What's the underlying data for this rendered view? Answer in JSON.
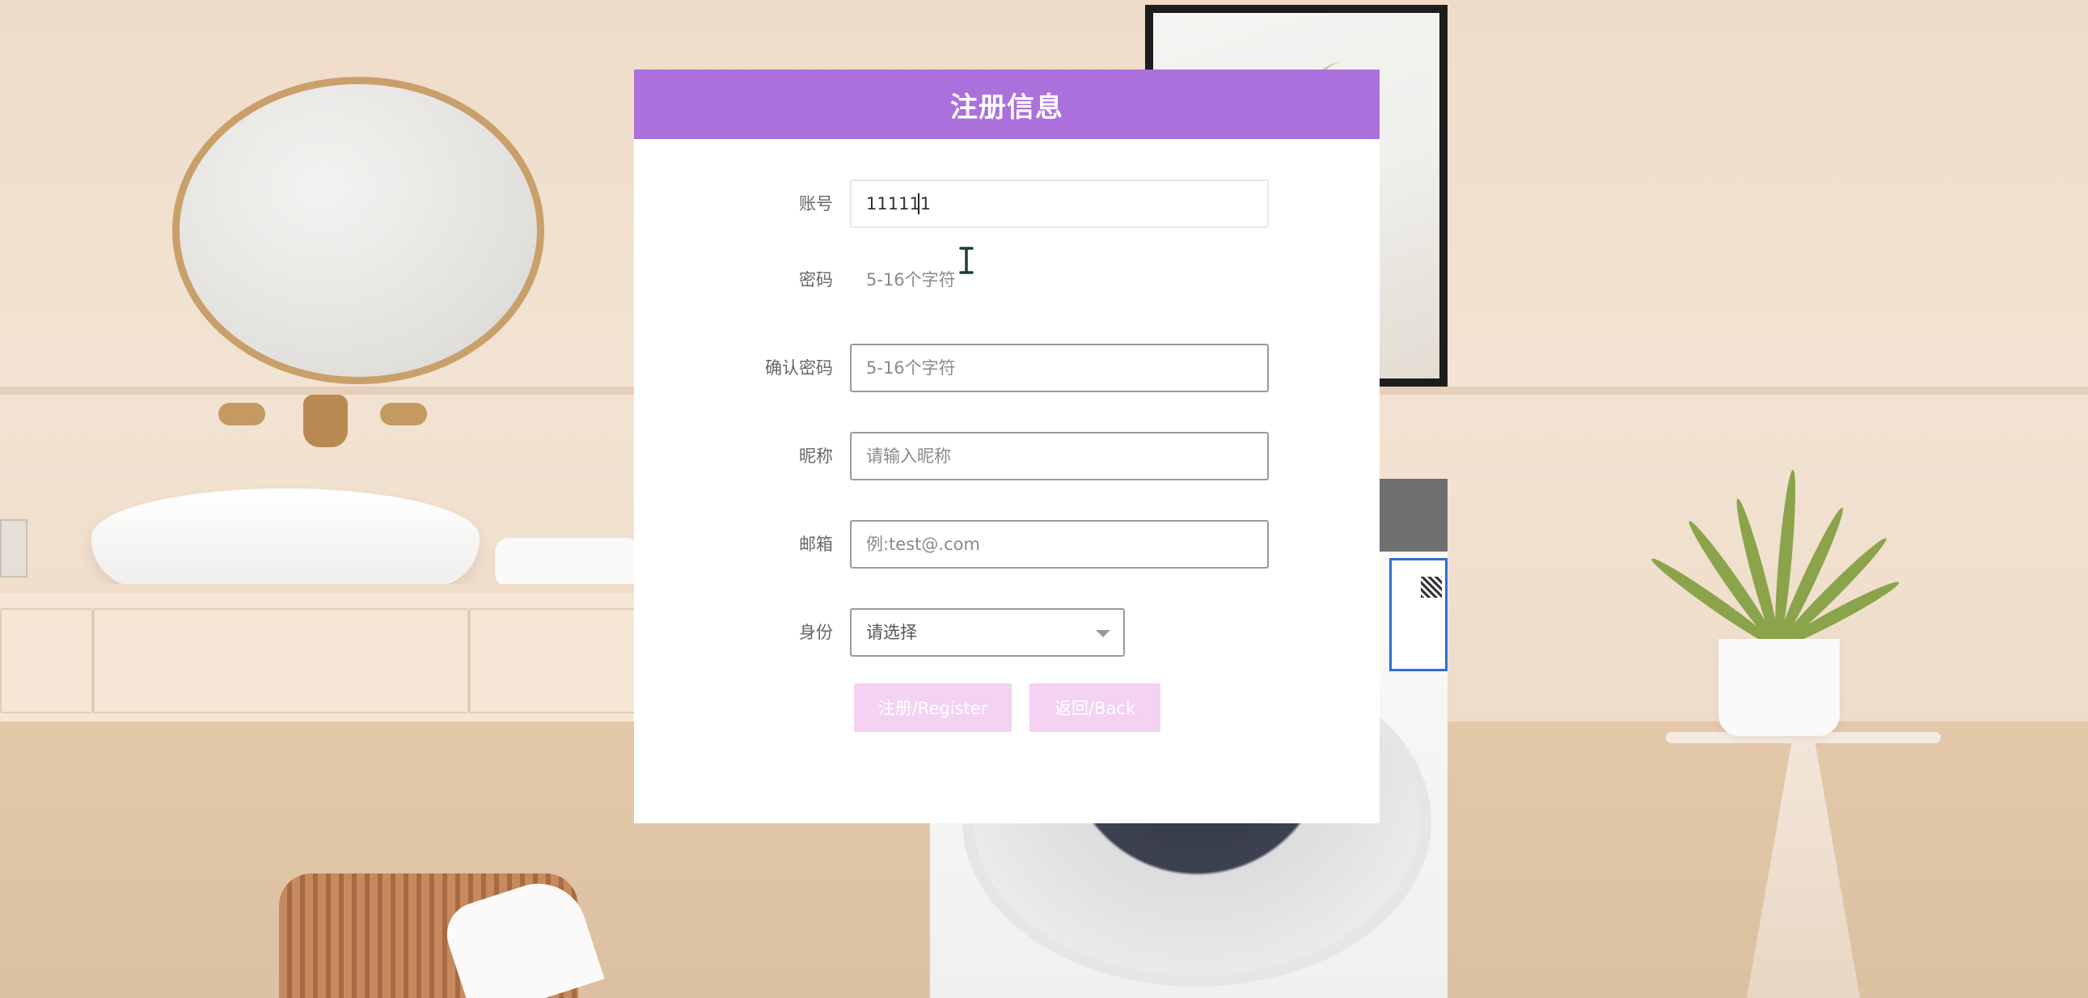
{
  "dialog": {
    "title": "注册信息"
  },
  "form": {
    "account": {
      "label": "账号",
      "value": "111111"
    },
    "password": {
      "label": "密码",
      "placeholder": "5-16个字符"
    },
    "confirm_password": {
      "label": "确认密码",
      "placeholder": "5-16个字符"
    },
    "nickname": {
      "label": "昵称",
      "placeholder": "请输入昵称"
    },
    "email": {
      "label": "邮箱",
      "placeholder": "例:test@.com"
    },
    "identity": {
      "label": "身份",
      "selected": "请选择"
    }
  },
  "buttons": {
    "register": "注册/Register",
    "back": "返回/Back"
  },
  "colors": {
    "header": "#ab70db",
    "button_bg": "#f3d2f4",
    "button_text": "#ffffff"
  },
  "icons": {
    "cursor": "text-cursor-icon",
    "dropdown": "chevron-down-icon"
  }
}
